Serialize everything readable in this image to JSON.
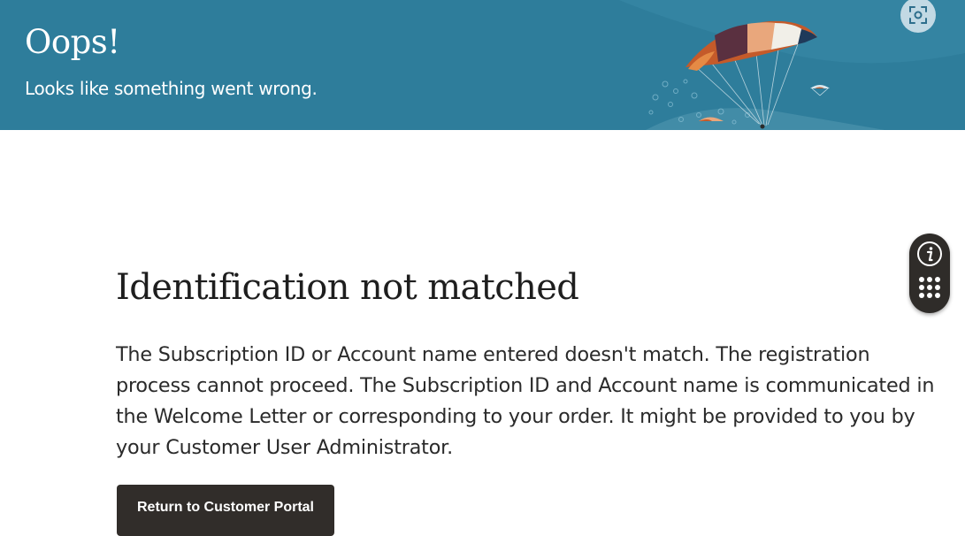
{
  "banner": {
    "title": "Oops!",
    "subtitle": "Looks like something went wrong.",
    "background_color": "#2e7d9b",
    "scan_icon": "scan-focus-icon"
  },
  "main": {
    "heading": "Identification not matched",
    "message": "The Subscription ID or Account name entered doesn't match. The registration process cannot proceed. The Subscription ID and Account name is communicated in the Welcome Letter or corresponding to your order. It might be provided to you by your Customer User Administrator.",
    "return_button_label": "Return to Customer Portal",
    "button_color": "#312d2a"
  },
  "side_widget": {
    "icons": [
      "info-icon",
      "apps-grid-icon"
    ],
    "background_color": "#2f2c29"
  }
}
